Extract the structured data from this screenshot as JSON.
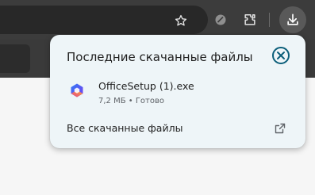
{
  "colors": {
    "toolbar_bg": "#3c3c3c",
    "popup_bg": "#eef5f8",
    "accent": "#0b5e7a",
    "text_primary": "#1f1f1f",
    "text_secondary": "#5f6368"
  },
  "toolbar": {
    "icons": [
      "star-icon",
      "extension-chip-icon",
      "puzzle-icon",
      "download-icon"
    ]
  },
  "downloads_popup": {
    "title": "Последние скачанные файлы",
    "items": [
      {
        "file_name": "OfficeSetup (1).exe",
        "status": "7,2 МБ • Готово",
        "icon": "microsoft-365-icon"
      }
    ],
    "all_downloads_label": "Все скачанные файлы"
  }
}
